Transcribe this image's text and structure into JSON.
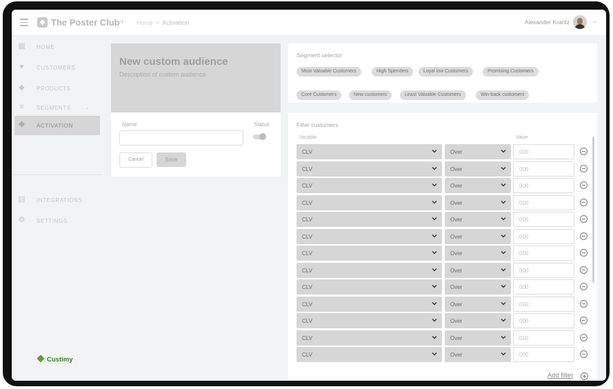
{
  "header": {
    "brand": "The Poster Club",
    "plus": "+",
    "breadcrumb": {
      "home": "Home",
      "separator": ">",
      "current": "Activation"
    },
    "user_name": "Alexander Krantz"
  },
  "sidebar": {
    "items": [
      {
        "label": "HOME",
        "icon": "dashboard-icon"
      },
      {
        "label": "CUSTOMERS",
        "icon": "heart-icon"
      },
      {
        "label": "PRODUCTS",
        "icon": "tag-icon"
      },
      {
        "label": "SEGMENTS",
        "icon": "layers-icon"
      },
      {
        "label": "ACTIVATION",
        "icon": "move-icon",
        "active": true
      }
    ],
    "bottom_items": [
      {
        "label": "INTEGRATIONS",
        "icon": "clipboard-icon"
      },
      {
        "label": "SETTINGS",
        "icon": "gear-icon"
      }
    ],
    "footer_logo": "Custimy"
  },
  "audience": {
    "title": "New custom audience",
    "description": "Description of custom audience",
    "name_label": "Name",
    "name_value": "",
    "status_label": "Status",
    "cancel_label": "Cancel",
    "save_label": "Save"
  },
  "segment_selector": {
    "title": "Segment selector",
    "chips": [
      "Most Valuable Customers",
      "High Spenders",
      "Loyal low Customers",
      "Promising Customers",
      "Core Customers",
      "New customers",
      "Least Valuable Customers",
      "Win-back customers"
    ]
  },
  "filter": {
    "title": "Filter customers",
    "variable_header": "Variable",
    "value_header": "Value",
    "rows": [
      {
        "variable": "CLV",
        "operator": "Over",
        "value_placeholder": "000"
      },
      {
        "variable": "CLV",
        "operator": "Over",
        "value_placeholder": "000"
      },
      {
        "variable": "CLV",
        "operator": "Over",
        "value_placeholder": "000"
      },
      {
        "variable": "CLV",
        "operator": "Over",
        "value_placeholder": "000"
      },
      {
        "variable": "CLV",
        "operator": "Over",
        "value_placeholder": "000"
      },
      {
        "variable": "CLV",
        "operator": "Over",
        "value_placeholder": "000"
      },
      {
        "variable": "CLV",
        "operator": "Over",
        "value_placeholder": "000"
      },
      {
        "variable": "CLV",
        "operator": "Over",
        "value_placeholder": "000"
      },
      {
        "variable": "CLV",
        "operator": "Over",
        "value_placeholder": "000"
      },
      {
        "variable": "CLV",
        "operator": "Over",
        "value_placeholder": "000"
      },
      {
        "variable": "CLV",
        "operator": "Over",
        "value_placeholder": "000"
      },
      {
        "variable": "CLV",
        "operator": "Over",
        "value_placeholder": "000"
      },
      {
        "variable": "CLV",
        "operator": "Over",
        "value_placeholder": "000"
      }
    ],
    "add_label": "Add filter"
  },
  "colors": {
    "accent_green": "#3a7d2a",
    "chip_bg": "#dcdcdc",
    "select_bg": "#d6d6d6"
  }
}
